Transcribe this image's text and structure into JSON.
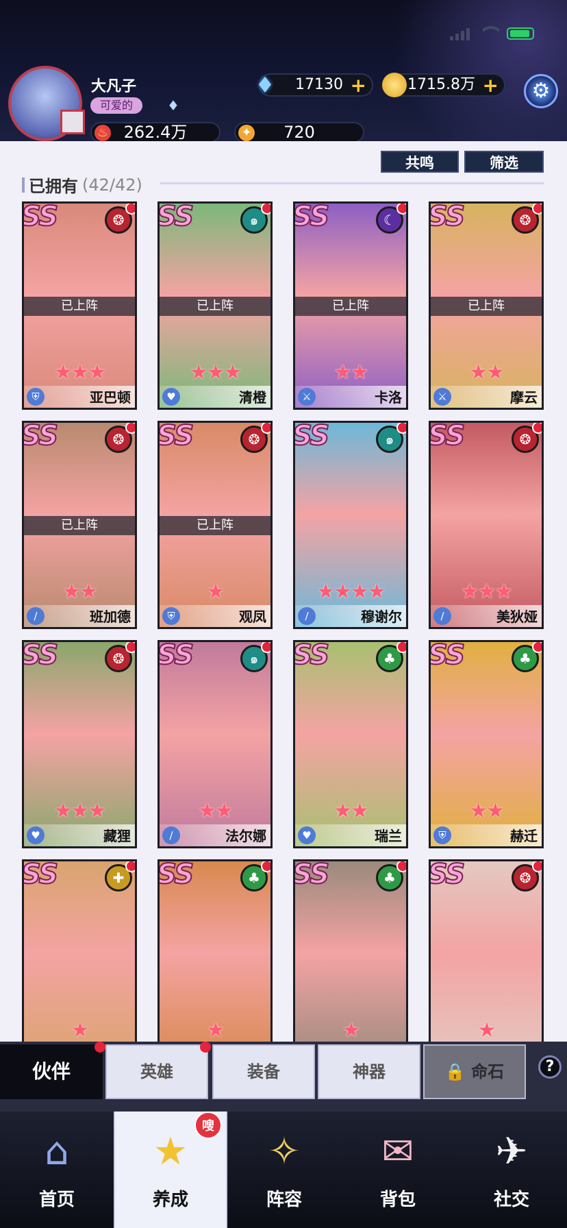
{
  "player": {
    "name": "大凡子",
    "tag": "可爱的",
    "power": "262.4万",
    "level_stat": "720"
  },
  "currency": {
    "diamonds": "17130",
    "gold": "1715.8万"
  },
  "buttons": {
    "resonance": "共鸣",
    "filter": "筛选"
  },
  "section": {
    "title": "已拥有",
    "count": "(42/42)"
  },
  "colors": {
    "card_bg": "#f4a3a3",
    "accent_red": "#e5233a",
    "star": "#ff5c76"
  },
  "heroes": [
    {
      "rank": "SS",
      "name": "亚巴顿",
      "deployed": "已上阵",
      "stars": "★★★",
      "element": "blood-element-icon",
      "role": "shield-role-icon",
      "bg": "#d9897a"
    },
    {
      "rank": "SS",
      "name": "清橙",
      "deployed": "已上阵",
      "stars": "★★★",
      "element": "wind-element-icon",
      "role": "heart-role-icon",
      "bg": "#7bb87a"
    },
    {
      "rank": "SS",
      "name": "卡洛",
      "deployed": "已上阵",
      "stars": "★★",
      "element": "moon-element-icon",
      "role": "sword-role-icon",
      "bg": "#8c5fc4"
    },
    {
      "rank": "SS",
      "name": "摩云",
      "deployed": "已上阵",
      "stars": "★★",
      "element": "blood-element-icon",
      "role": "sword-role-icon",
      "bg": "#d7b35e"
    },
    {
      "rank": "SS",
      "name": "班加德",
      "deployed": "已上阵",
      "stars": "★★",
      "element": "blood-element-icon",
      "role": "claw-role-icon",
      "bg": "#b88a6e"
    },
    {
      "rank": "SS",
      "name": "观凤",
      "deployed": "已上阵",
      "stars": "★",
      "element": "blood-element-icon",
      "role": "shield-role-icon",
      "bg": "#d88a66"
    },
    {
      "rank": "SS",
      "name": "穆谢尔",
      "deployed": "",
      "stars": "★★★★",
      "element": "wind-element-icon",
      "role": "claw-role-icon",
      "bg": "#6cb8d8"
    },
    {
      "rank": "SS",
      "name": "美狄娅",
      "deployed": "",
      "stars": "★★★",
      "element": "blood-element-icon",
      "role": "claw-role-icon",
      "bg": "#c35a62"
    },
    {
      "rank": "SS",
      "name": "藏狸",
      "deployed": "",
      "stars": "★★★",
      "element": "blood-element-icon",
      "role": "heart-role-icon",
      "bg": "#8aa76c"
    },
    {
      "rank": "SS",
      "name": "法尔娜",
      "deployed": "",
      "stars": "★★",
      "element": "wind-element-icon",
      "role": "claw-role-icon",
      "bg": "#c07a9c"
    },
    {
      "rank": "SS",
      "name": "瑞兰",
      "deployed": "",
      "stars": "★★",
      "element": "leaf-element-icon",
      "role": "heart-role-icon",
      "bg": "#a8c070"
    },
    {
      "rank": "SS",
      "name": "赫迁",
      "deployed": "",
      "stars": "★★",
      "element": "leaf-element-icon",
      "role": "shield-role-icon",
      "bg": "#e0b040"
    },
    {
      "rank": "SS",
      "name": "",
      "deployed": "",
      "stars": "★",
      "element": "gold-element-icon",
      "role": "",
      "bg": "#d9a46e"
    },
    {
      "rank": "SS",
      "name": "",
      "deployed": "",
      "stars": "★",
      "element": "leaf-element-icon",
      "role": "",
      "bg": "#d8894e"
    },
    {
      "rank": "SS",
      "name": "",
      "deployed": "",
      "stars": "★",
      "element": "leaf-element-icon",
      "role": "",
      "bg": "#9a8a7c"
    },
    {
      "rank": "SS",
      "name": "",
      "deployed": "",
      "stars": "★",
      "element": "blood-element-icon",
      "role": "",
      "bg": "#e3c9c0"
    }
  ],
  "tabs": [
    {
      "label": "伙伴",
      "active": true
    },
    {
      "label": "英雄"
    },
    {
      "label": "装备"
    },
    {
      "label": "神器"
    },
    {
      "label": "命石",
      "locked": true
    }
  ],
  "nav": [
    {
      "label": "首页",
      "icon": "home-icon"
    },
    {
      "label": "养成",
      "icon": "star-upgrade-icon",
      "active": true
    },
    {
      "label": "阵容",
      "icon": "formation-icon"
    },
    {
      "label": "背包",
      "icon": "bag-icon"
    },
    {
      "label": "社交",
      "icon": "social-icon"
    }
  ],
  "nav_badge": "嗖"
}
